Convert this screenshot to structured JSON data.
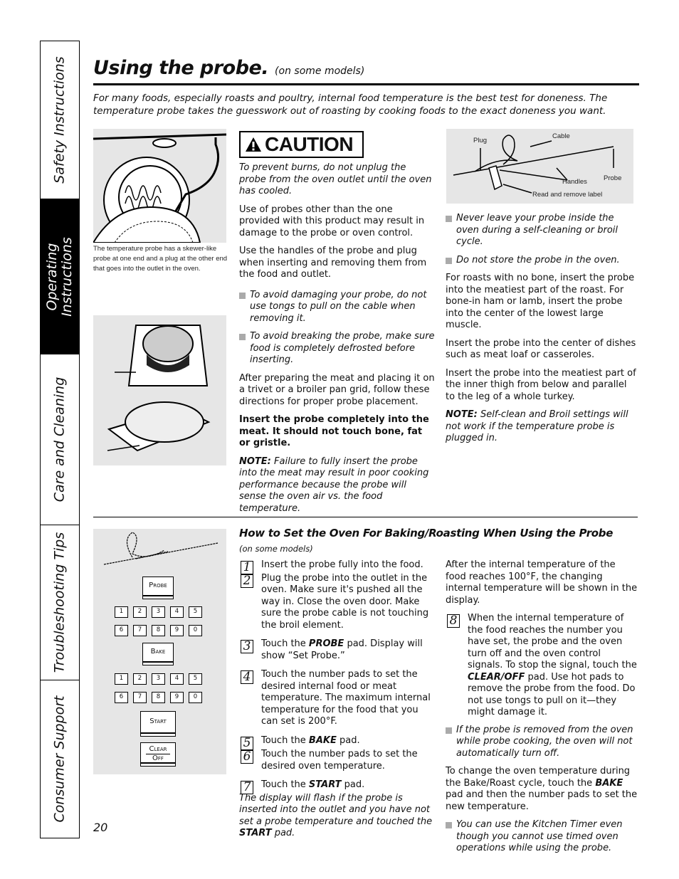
{
  "side_tabs": [
    {
      "label": "Safety Instructions",
      "active": false
    },
    {
      "label": "Operating Instructions",
      "active": true
    },
    {
      "label": "Care and Cleaning",
      "active": false
    },
    {
      "label": "Troubleshooting Tips",
      "active": false
    },
    {
      "label": "Consumer Support",
      "active": false
    }
  ],
  "header": {
    "title": "Using the probe.",
    "subtitle": "(on some models)",
    "intro": "For many foods, especially roasts and poultry, internal food temperature is the best test for doneness. The temperature probe takes the guesswork out of roasting by cooking foods to the exact doneness you want."
  },
  "figures": {
    "probe_in_oven_caption": "The temperature probe has a skewer-like probe at one end and a plug at the other end that goes into the outlet in the oven.",
    "probe_diagram_labels": {
      "plug": "Plug",
      "cable": "Cable",
      "handles": "Handles",
      "probe": "Probe",
      "label": "Read and remove label"
    }
  },
  "caution": {
    "label": "CAUTION",
    "warning": "To prevent burns, do not unplug the probe from the oven outlet until the oven has cooled.",
    "p1": "Use of probes other than the one provided with this product may result in damage to the probe or oven control.",
    "p2": "Use the handles of the probe and plug when inserting and removing them from the food and outlet.",
    "bullet1": "To avoid damaging your probe, do not use tongs to pull on the cable when removing it.",
    "bullet2": "To avoid breaking the probe, make sure food is completely defrosted before inserting.",
    "p3": "After preparing the meat and placing it on a trivet or a broiler pan grid, follow these directions for proper probe placement.",
    "bold": "Insert the probe completely into the meat. It should not touch bone, fat or gristle.",
    "note_label": "NOTE:",
    "note": " Failure to fully insert the probe into the meat may result in poor cooking performance because the probe will sense the oven air vs. the food temperature."
  },
  "right_col": {
    "bullet1": "Never leave your probe inside the oven during a self-cleaning or broil cycle.",
    "bullet2": "Do not store the probe in the oven.",
    "p1": "For roasts with no bone, insert the probe into the meatiest part of the roast. For bone-in ham or lamb, insert the probe into the center of the lowest large muscle.",
    "p2": "Insert the probe into the center of dishes such as meat loaf or casseroles.",
    "p3": "Insert the probe into the meatiest part of the inner thigh from below and parallel to the leg of a whole turkey.",
    "note_label": "NOTE:",
    "note": " Self-clean and Broil settings will not work if the temperature probe is plugged in."
  },
  "howto": {
    "title": "How to Set the Oven For Baking/Roasting When Using the Probe",
    "subtitle": "(on some models)",
    "steps": [
      {
        "n": "1",
        "text": "Insert the probe fully into the food."
      },
      {
        "n": "2",
        "text": "Plug the probe into the outlet in the oven. Make sure it's pushed all the way in. Close the oven door. Make sure the probe cable is not touching the broil element."
      },
      {
        "n": "3",
        "pre": "Touch the ",
        "bold": "PROBE",
        "post": "  pad. Display will show “Set Probe.”"
      },
      {
        "n": "4",
        "text": "Touch the number pads to set the desired internal food or meat temperature. The maximum internal temperature for the food that you can set is 200°F."
      },
      {
        "n": "5",
        "pre": "Touch the ",
        "bold": "BAKE",
        "post": " pad."
      },
      {
        "n": "6",
        "text": "Touch the number pads to set the desired oven temperature."
      },
      {
        "n": "7",
        "pre": "Touch the ",
        "bold": "START",
        "post": " pad."
      },
      {
        "n": "8",
        "pre": "When the internal temperature of the food reaches the number you have set, the probe and the oven turn off and the oven control signals. To stop the signal, touch the ",
        "bold": "CLEAR/OFF",
        "post": " pad. Use hot pads to remove the probe from the food. Do not use tongs to pull on it—they might damage it."
      }
    ],
    "flash_pre": "The display will flash if the probe is inserted into the outlet and you have not set a probe temperature and touched the ",
    "flash_bold": "START",
    "flash_post": " pad.",
    "after_temp": "After the internal temperature of the food reaches 100°F, the changing internal temperature will be shown in the display.",
    "bullet_removed": "If the probe is removed from the oven while probe cooking, the oven will not automatically turn off.",
    "change_pre": "To change the oven temperature during the Bake/Roast cycle, touch the ",
    "change_bold": "BAKE",
    "change_post": " pad and then the number pads to set the new temperature.",
    "bullet_timer": "You can use the Kitchen Timer even though you cannot use timed oven operations while using the probe."
  },
  "keypad": {
    "probe": "Probe",
    "bake": "Bake",
    "start": "Start",
    "clear": "Clear",
    "off": "Off",
    "row1": [
      "1",
      "2",
      "3",
      "4",
      "5"
    ],
    "row2": [
      "6",
      "7",
      "8",
      "9",
      "0"
    ]
  },
  "page_number": "20"
}
